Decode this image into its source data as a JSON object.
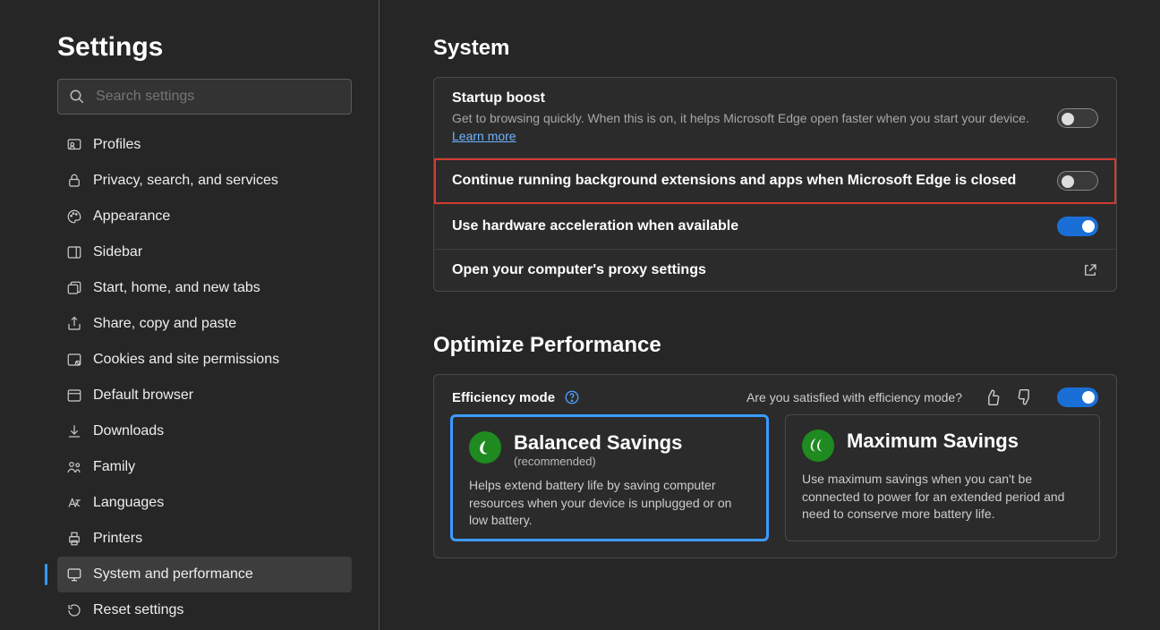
{
  "sidebar": {
    "title": "Settings",
    "search_placeholder": "Search settings",
    "items": [
      {
        "label": "Profiles"
      },
      {
        "label": "Privacy, search, and services"
      },
      {
        "label": "Appearance"
      },
      {
        "label": "Sidebar"
      },
      {
        "label": "Start, home, and new tabs"
      },
      {
        "label": "Share, copy and paste"
      },
      {
        "label": "Cookies and site permissions"
      },
      {
        "label": "Default browser"
      },
      {
        "label": "Downloads"
      },
      {
        "label": "Family"
      },
      {
        "label": "Languages"
      },
      {
        "label": "Printers"
      },
      {
        "label": "System and performance"
      },
      {
        "label": "Reset settings"
      }
    ],
    "active_index": 12
  },
  "system": {
    "heading": "System",
    "startup_boost": {
      "title": "Startup boost",
      "desc": "Get to browsing quickly. When this is on, it helps Microsoft Edge open faster when you start your device.",
      "learn_more": "Learn more",
      "on": false
    },
    "background_apps": {
      "title": "Continue running background extensions and apps when Microsoft Edge is closed",
      "on": false,
      "highlighted": true
    },
    "hw_accel": {
      "title": "Use hardware acceleration when available",
      "on": true
    },
    "proxy": {
      "title": "Open your computer's proxy settings"
    }
  },
  "optimize": {
    "heading": "Optimize Performance",
    "efficiency_label": "Efficiency mode",
    "feedback_prompt": "Are you satisfied with efficiency mode?",
    "toggle_on": true,
    "balanced": {
      "title": "Balanced Savings",
      "subtitle": "(recommended)",
      "desc": "Helps extend battery life by saving computer resources when your device is unplugged or on low battery."
    },
    "maximum": {
      "title": "Maximum Savings",
      "desc": "Use maximum savings when you can't be connected to power for an extended period and need to conserve more battery life."
    }
  }
}
